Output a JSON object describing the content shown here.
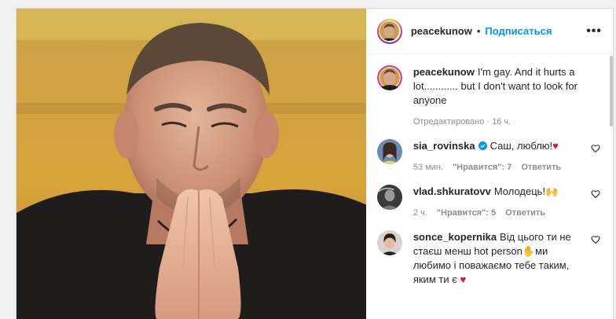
{
  "post": {
    "author": "peacekunow",
    "separator": "•",
    "follow_label": "Подписаться",
    "more_label": "•••",
    "caption": {
      "username": "peacekunow",
      "text": "I'm gay. And it hurts a lot............ but I don't want to look for anyone",
      "edited_label": "Отредактировано",
      "time": "16 ч."
    }
  },
  "comments": [
    {
      "username": "sia_rovinska",
      "verified": true,
      "text": "Саш, люблю!",
      "emoji": "♥",
      "time": "53 мин.",
      "likes": "\"Нравится\": 7",
      "reply": "Ответить"
    },
    {
      "username": "vlad.shkuratovv",
      "verified": false,
      "text": "Молодець!",
      "emoji": "🙌",
      "time": "2 ч.",
      "likes": "\"Нравится\": 5",
      "reply": "Ответить"
    },
    {
      "username": "sonce_kopernika",
      "verified": false,
      "text": "Від цього ти не стаєш менш hot person",
      "text2": "ми любимо і поважаємо тебе таким, яким ти є",
      "emoji_mid": "✋",
      "emoji": "♥"
    }
  ],
  "icons": {
    "follow_dot": "dot-icon",
    "more": "more-options-icon",
    "like": "heart-outline-icon",
    "verified": "verified-badge-icon"
  },
  "colors": {
    "accent": "#0095f6",
    "text": "#262626",
    "muted": "#8e8e8e",
    "heart": "#e0112b"
  }
}
